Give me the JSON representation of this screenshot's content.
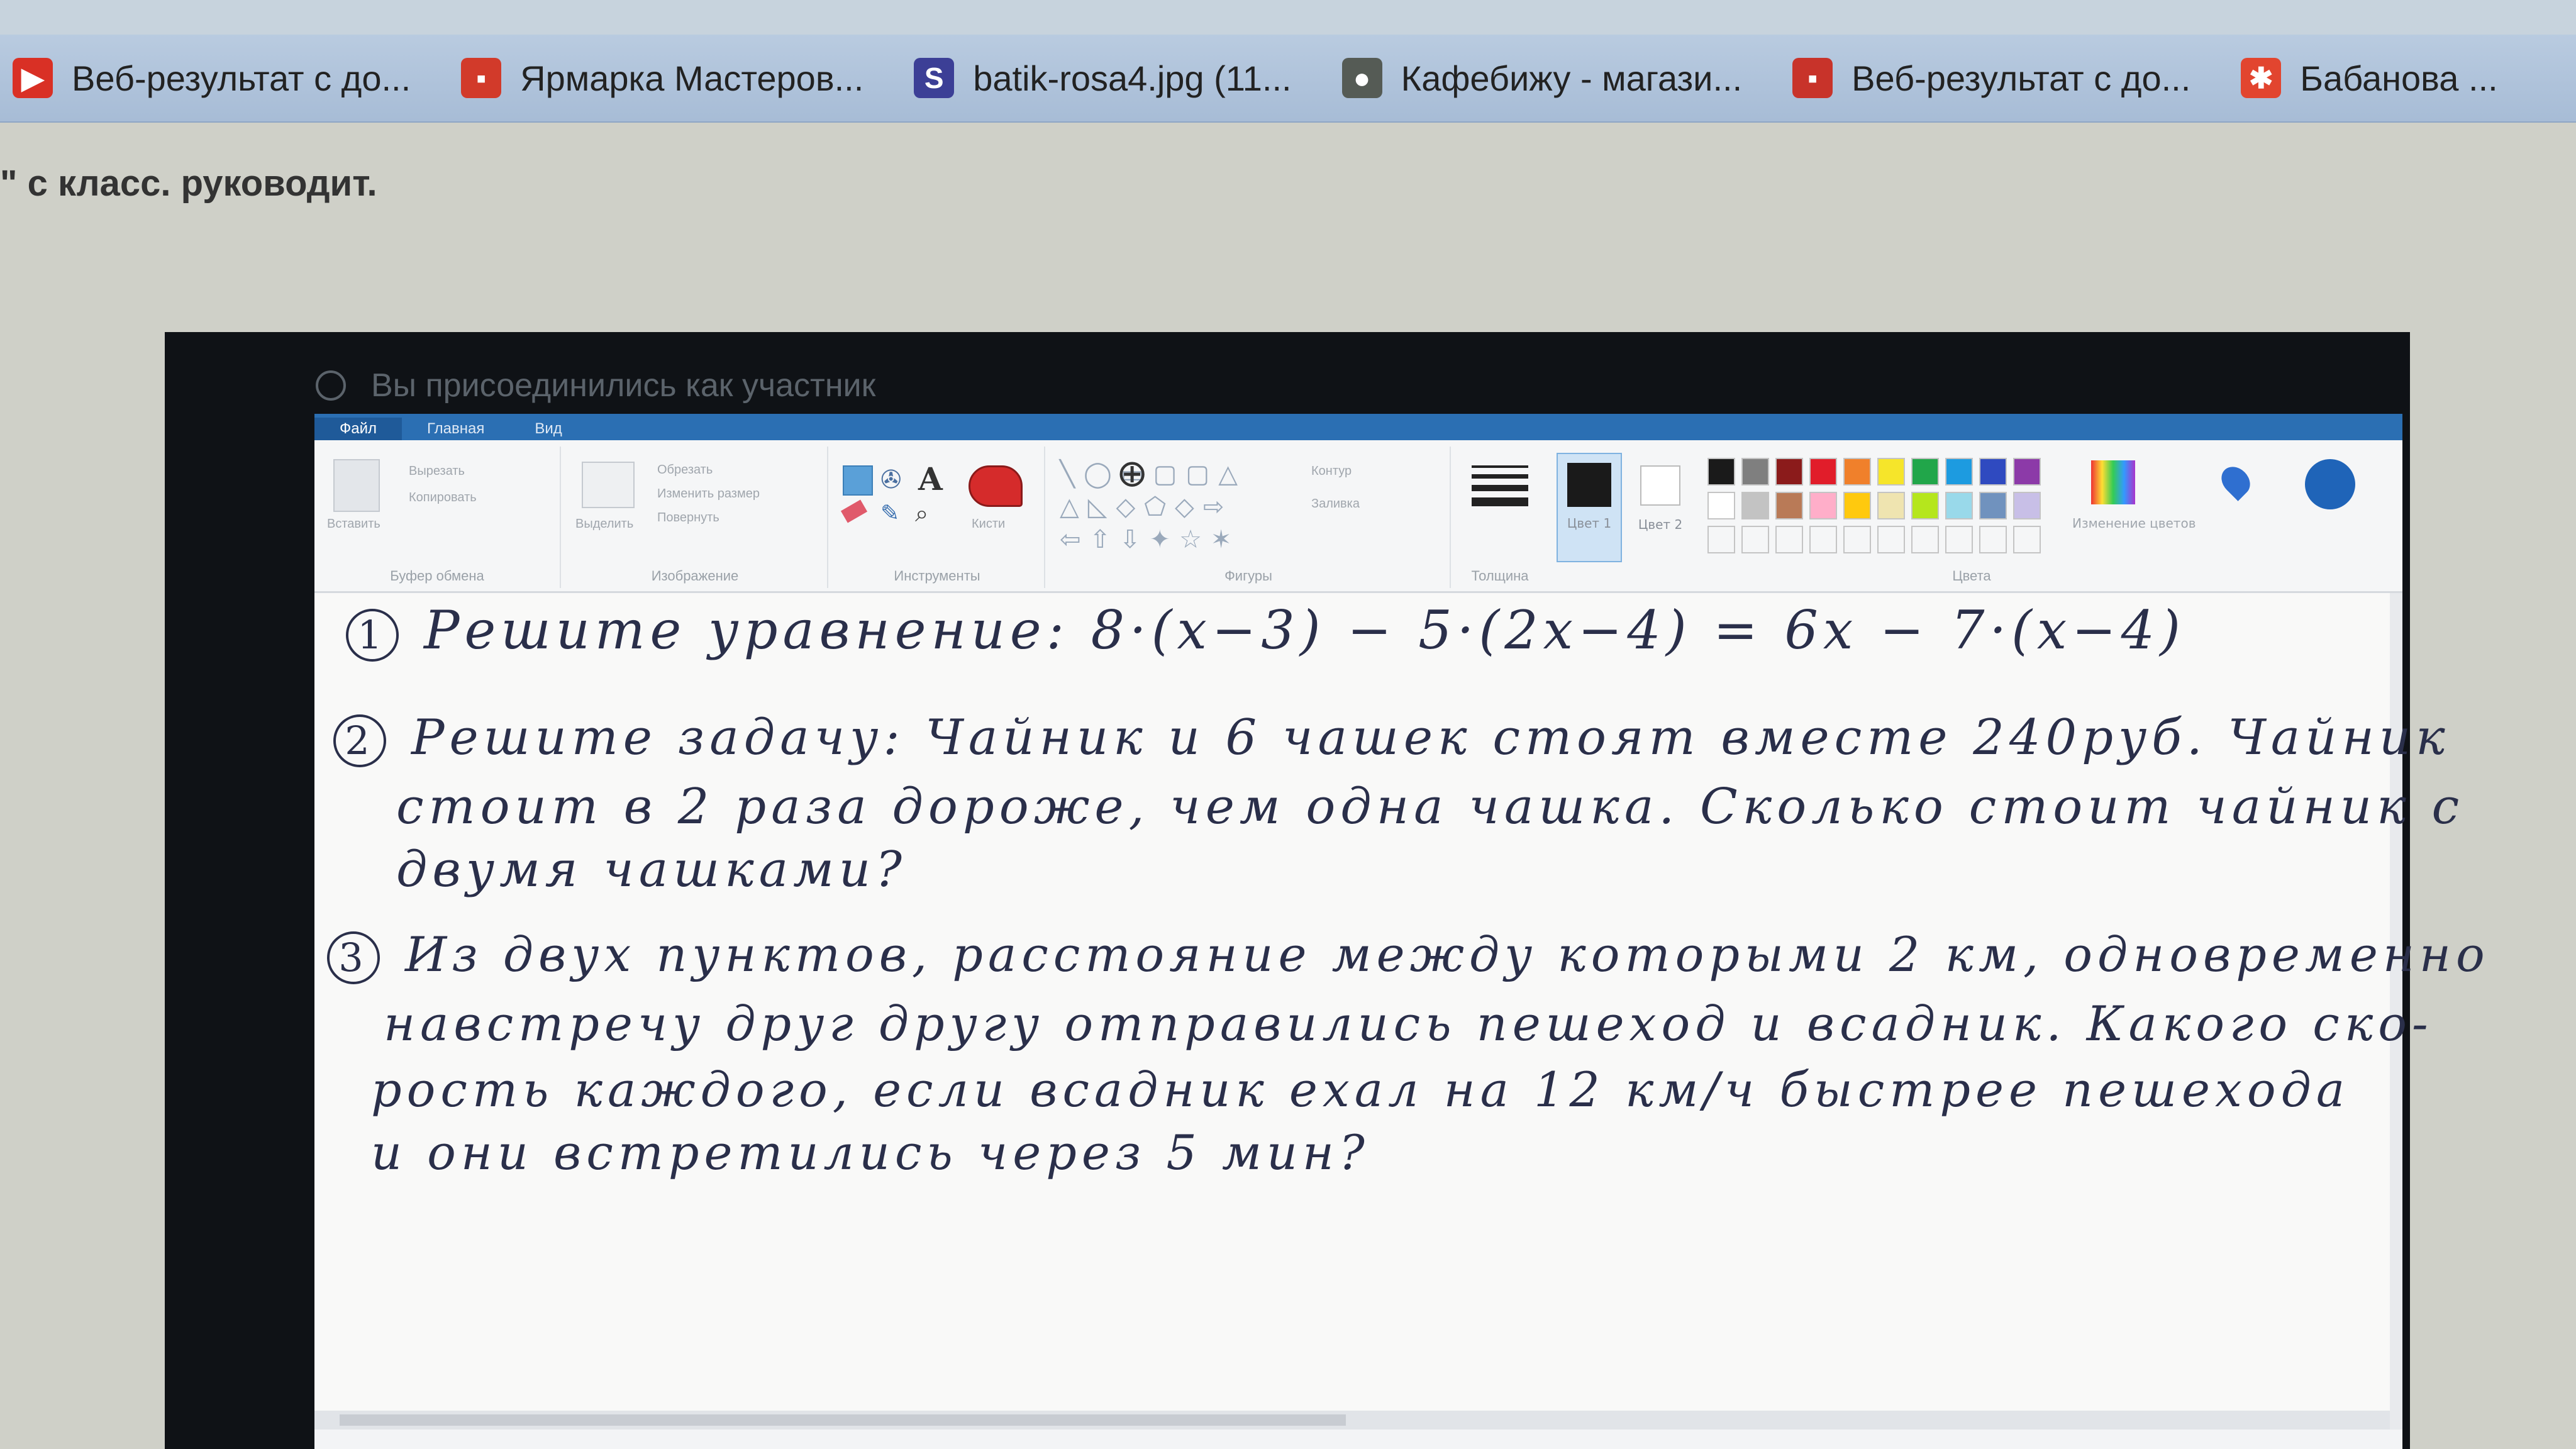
{
  "browser": {
    "bookmarks": [
      {
        "label": "Веб-результат с до...",
        "icon": "youtube-icon",
        "color": "#d93025",
        "glyph": "▶"
      },
      {
        "label": "Ярмарка Мастеров...",
        "icon": "craft-fair-icon",
        "color": "#d23a2a",
        "glyph": "▪"
      },
      {
        "label": "batik-rosa4.jpg (11...",
        "icon": "image-s-icon",
        "color": "#3c3f96",
        "glyph": "S"
      },
      {
        "label": "Кафебижу - магази...",
        "icon": "shop-icon",
        "color": "#555b55",
        "glyph": "●"
      },
      {
        "label": "Веб-результат с до...",
        "icon": "web-result-icon",
        "color": "#c8332a",
        "glyph": "▪"
      },
      {
        "label": "Бабанова ...",
        "icon": "gift-icon",
        "color": "#e2452f",
        "glyph": "✱"
      }
    ],
    "page_heading": "\" с класс. руководит."
  },
  "shared_screen": {
    "status_text": "Вы присоединились как участник"
  },
  "paint": {
    "menu_tabs": [
      "Файл",
      "Главная",
      "Вид"
    ],
    "ribbon_groups": [
      {
        "label": "Буфер обмена",
        "items": [
          "Вставить",
          "Вырезать",
          "Копировать"
        ]
      },
      {
        "label": "Изображение",
        "items": [
          "Выделить",
          "Обрезать",
          "Изменить размер",
          "Повернуть"
        ]
      },
      {
        "label": "Инструменты",
        "items": [
          "Кисти"
        ]
      },
      {
        "label": "Фигуры",
        "items": [
          "Контур",
          "Заливка"
        ]
      },
      {
        "label": "Толщина"
      },
      {
        "label": "Цвета",
        "items": [
          "Цвет 1",
          "Цвет 2",
          "Изменение цветов"
        ]
      }
    ],
    "palette": [
      "#1a1a1a",
      "#7f7f7f",
      "#8b1b1b",
      "#e11d2a",
      "#f0802b",
      "#f6e52a",
      "#21a64a",
      "#1d9be0",
      "#2f4ac0",
      "#8c3aa8",
      "#ffffff",
      "#c3c3c3",
      "#b97a57",
      "#ffaec9",
      "#ffc90e",
      "#efe4b0",
      "#b5e61d",
      "#99d9ea",
      "#7092be",
      "#c8bfe7"
    ],
    "active_color1": "#1a1a1a",
    "active_color2": "#ffffff"
  },
  "handwriting": {
    "task1": {
      "num": "1",
      "text": "Решите уравнение: 8·(х−3) − 5·(2х−4) = 6х − 7·(х−4)"
    },
    "task2": {
      "num": "2",
      "line1": "Решите задачу: Чайник и 6 чашек стоят вместе 240руб. Чайник",
      "line2": "стоит в 2 раза дороже, чем одна чашка. Сколько стоит чайник с",
      "line3": "двумя чашками?"
    },
    "task3": {
      "num": "3",
      "line1": "Из двух пунктов, расстояние между которыми 2 км, одновременно",
      "line2": "навстречу друг другу отправились пешеход и всадник. Какого ско-",
      "line3": "рость каждого, если всадник ехал на 12 км/ч быстрее пешехода",
      "line4": "и они встретились через 5 мин?"
    }
  }
}
